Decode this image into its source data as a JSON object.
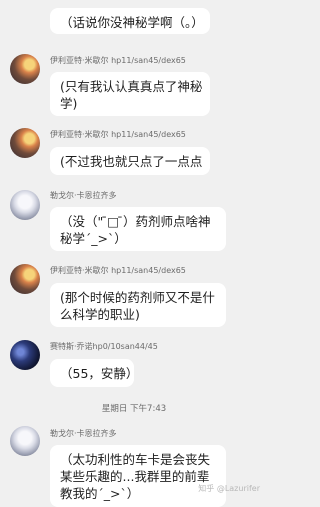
{
  "messages": [
    {
      "name": "",
      "avatar_icon": "",
      "lines": [
        "（话说你没神秘学啊（。）"
      ]
    },
    {
      "name": "伊利亚特·米歇尔 hp11/san45/dex65",
      "avatar_icon": "sunset-avatar-icon",
      "lines": [
        "(只有我认认真真点了神秘",
        "学)"
      ]
    },
    {
      "name": "伊利亚特·米歇尔 hp11/san45/dex65",
      "avatar_icon": "sunset-avatar-icon",
      "lines": [
        "(不过我也就只点了一点点"
      ]
    },
    {
      "name": "勒戈尔·卡恩拉齐多",
      "avatar_icon": "anime-avatar-icon",
      "lines": [
        "（没（\" ̄□ ̄）药剂师点啥神",
        "秘学´_>`）"
      ]
    },
    {
      "name": "伊利亚特·米歇尔 hp11/san45/dex65",
      "avatar_icon": "sunset-avatar-icon",
      "lines": [
        "(那个时候的药剂师又不是什",
        "么科学的职业)"
      ]
    },
    {
      "name": "赛特斯·乔诺hp0/10san44/45",
      "avatar_icon": "dark-avatar-icon",
      "lines": [
        "（55，安静）"
      ]
    },
    {
      "name": "勒戈尔·卡恩拉齐多",
      "avatar_icon": "anime-avatar-icon",
      "lines": [
        "（太功利性的车卡是会丧失",
        "某些乐趣的...我群里的前辈",
        "教我的´_>`）"
      ]
    }
  ],
  "timestamp": "星期日 下午7:43",
  "watermark": "知乎 @Lazurifer"
}
